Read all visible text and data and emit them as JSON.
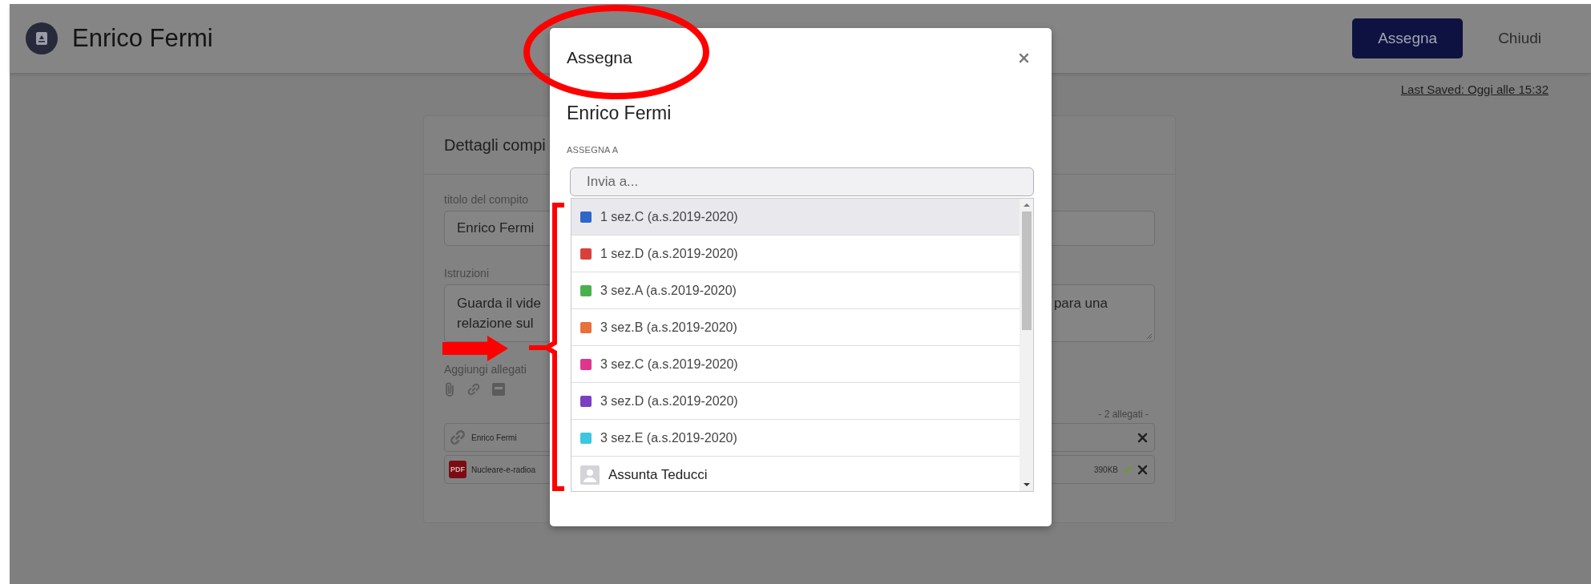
{
  "header": {
    "title": "Enrico Fermi",
    "buttons": [
      {
        "label": "Assegna",
        "kind": "primary"
      },
      {
        "label": "Chiudi",
        "kind": "plain"
      }
    ]
  },
  "last_saved": "Last Saved: Oggi alle 15:32",
  "task_card": {
    "title": "Dettagli compi",
    "title_label": "titolo del compito",
    "title_value": "Enrico Fermi",
    "instructions_label": "Istruzioni",
    "instructions_left": [
      "Guarda il vide",
      "relazione sul"
    ],
    "instructions_right": "para una",
    "attachments_label": "Aggiungi allegati",
    "attachment_count": "- 2 allegati -",
    "attachments": [
      {
        "kind": "link",
        "name": "Enrico Fermi",
        "uploaded": false
      },
      {
        "kind": "pdf",
        "file_type": "PDF",
        "name": "Nucleare-e-radioa",
        "size": "390KB",
        "uploaded": true
      }
    ]
  },
  "modal": {
    "title": "Assegna",
    "subtitle": "Enrico Fermi",
    "field_label": "ASSEGNA A",
    "search": {
      "placeholder": "Invia a..."
    },
    "options": [
      {
        "kind": "class",
        "label": "1 sez.C (a.s.2019-2020)",
        "color": "#2f66c8",
        "selected": true
      },
      {
        "kind": "class",
        "label": "1 sez.D (a.s.2019-2020)",
        "color": "#d9403a",
        "selected": false
      },
      {
        "kind": "class",
        "label": "3 sez.A (a.s.2019-2020)",
        "color": "#4caf50",
        "selected": false
      },
      {
        "kind": "class",
        "label": "3 sez.B (a.s.2019-2020)",
        "color": "#e8703a",
        "selected": false
      },
      {
        "kind": "class",
        "label": "3 sez.C (a.s.2019-2020)",
        "color": "#e0358f",
        "selected": false
      },
      {
        "kind": "class",
        "label": "3 sez.D (a.s.2019-2020)",
        "color": "#7b3fc4",
        "selected": false
      },
      {
        "kind": "class",
        "label": "3 sez.E (a.s.2019-2020)",
        "color": "#3cc6e0",
        "selected": false
      },
      {
        "kind": "person",
        "label": "Assunta Teducci",
        "selected": false
      }
    ]
  }
}
